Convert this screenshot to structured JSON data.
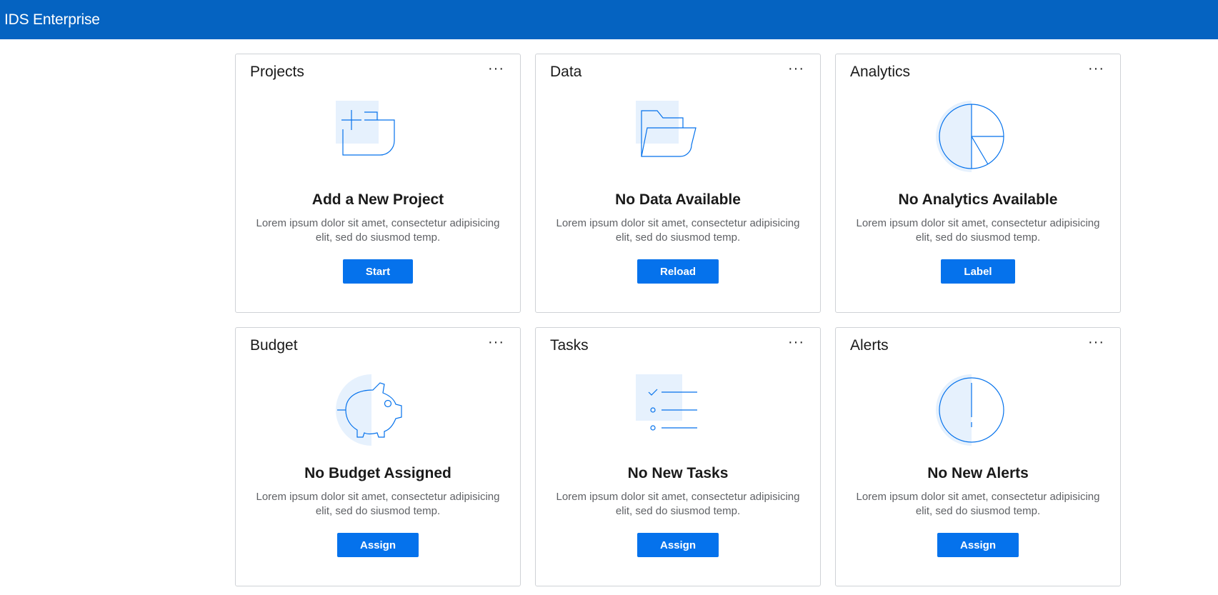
{
  "app": {
    "title": "IDS Enterprise"
  },
  "colors": {
    "header": "#0563c1",
    "accent": "#0572ec",
    "illustration_fill": "#e6f1fd",
    "illustration_stroke": "#0572ec"
  },
  "menu_icon": "ellipsis-horizontal-icon",
  "cards": [
    {
      "title": "Projects",
      "menu": "···",
      "icon": "new-project-icon",
      "empty_title": "Add a New Project",
      "description": "Lorem ipsum dolor sit amet, consectetur adipisicing elit, sed do siusmod temp.",
      "button": "Start"
    },
    {
      "title": "Data",
      "menu": "···",
      "icon": "folder-icon",
      "empty_title": "No Data Available",
      "description": "Lorem ipsum dolor sit amet, consectetur adipisicing elit, sed do siusmod temp.",
      "button": "Reload"
    },
    {
      "title": "Analytics",
      "menu": "···",
      "icon": "pie-chart-icon",
      "empty_title": "No Analytics Available",
      "description": "Lorem ipsum dolor sit amet, consectetur adipisicing elit, sed do siusmod temp.",
      "button": "Label"
    },
    {
      "title": "Budget",
      "menu": "···",
      "icon": "piggy-bank-icon",
      "empty_title": "No Budget Assigned",
      "description": "Lorem ipsum dolor sit amet, consectetur adipisicing elit, sed do siusmod temp.",
      "button": "Assign"
    },
    {
      "title": "Tasks",
      "menu": "···",
      "icon": "task-list-icon",
      "empty_title": "No New Tasks",
      "description": "Lorem ipsum dolor sit amet, consectetur adipisicing elit, sed do siusmod temp.",
      "button": "Assign"
    },
    {
      "title": "Alerts",
      "menu": "···",
      "icon": "alert-icon",
      "empty_title": "No New Alerts",
      "description": "Lorem ipsum dolor sit amet, consectetur adipisicing elit, sed do siusmod temp.",
      "button": "Assign"
    }
  ]
}
